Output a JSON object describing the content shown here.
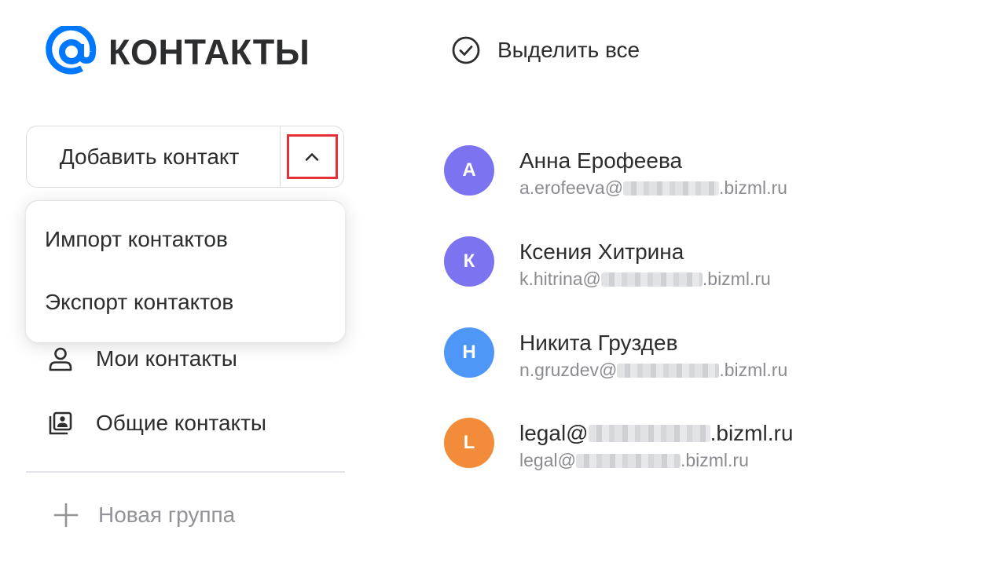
{
  "app": {
    "title": "КОНТАКТЫ",
    "logo_icon": "at-sign-icon",
    "brand_color": "#0077ff"
  },
  "toolbar": {
    "select_all_label": "Выделить все",
    "select_all_icon": "check-circle-icon"
  },
  "sidebar": {
    "add_contact_label": "Добавить контакт",
    "toggle_icon": "chevron-up-icon",
    "highlight_color": "#e5303a",
    "dropdown": {
      "items": [
        {
          "label": "Импорт контактов"
        },
        {
          "label": "Экспорт контактов"
        }
      ]
    },
    "nav": [
      {
        "label": "Мои контакты",
        "icon": "person-icon"
      },
      {
        "label": "Общие контакты",
        "icon": "shared-contacts-icon"
      }
    ],
    "new_group": {
      "label": "Новая группа",
      "icon": "plus-icon"
    }
  },
  "contacts": [
    {
      "initial": "А",
      "name": "Анна Ерофеева",
      "email_prefix": "a.erofeeva@",
      "email_suffix": ".bizml.ru",
      "avatar_color": "#7b73f0"
    },
    {
      "initial": "К",
      "name": "Ксения Хитрина",
      "email_prefix": "k.hitrina@",
      "email_suffix": ".bizml.ru",
      "avatar_color": "#7b73f0"
    },
    {
      "initial": "Н",
      "name": "Никита Груздев",
      "email_prefix": "n.gruzdev@",
      "email_suffix": ".bizml.ru",
      "avatar_color": "#4f97f7"
    },
    {
      "initial": "L",
      "name_prefix": "legal@",
      "name_suffix": ".bizml.ru",
      "email_prefix": "legal@",
      "email_suffix": ".bizml.ru",
      "avatar_color": "#f28c3a"
    }
  ]
}
